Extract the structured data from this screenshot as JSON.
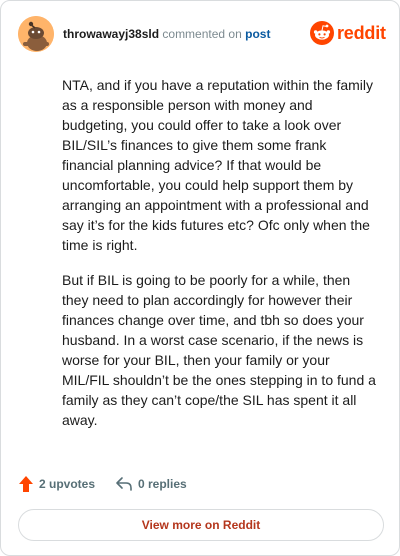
{
  "header": {
    "username": "throwawayj38sld",
    "action_text": "commented on",
    "post_link_label": "post",
    "avatar_icon": "snoo-avatar-icon",
    "brand": {
      "icon": "reddit-logo-icon",
      "wordmark": "reddit"
    }
  },
  "comment": {
    "paragraphs": [
      "NTA, and if you have a reputation within the family as a responsible person with money and budgeting, you could offer to take a look over BIL/SIL’s finances to give them some frank financial planning advice? If that would be uncomfortable, you could help support them by arranging an appointment with a professional and say it’s for the kids futures etc? Ofc only when the time is right.",
      "But if BIL is going to be poorly for a while, then they need to plan accordingly for however their finances change over time, and tbh so does your husband. In a worst case scenario, if the news is worse for your BIL, then your family or your MIL/FIL shouldn’t be the ones stepping in to fund a family as they can’t cope/the SIL has spent it all away."
    ]
  },
  "actions": {
    "upvotes_label": "2 upvotes",
    "upvote_icon": "upvote-arrow-icon",
    "replies_label": "0 replies",
    "reply_icon": "reply-arrow-icon"
  },
  "footer": {
    "view_more_label": "View more on Reddit"
  },
  "colors": {
    "brand_orange": "#ff4500",
    "link_blue": "#0a5aa0",
    "view_more_text": "#b4361c",
    "border": "#d9dcde",
    "muted_text": "#576f76"
  }
}
